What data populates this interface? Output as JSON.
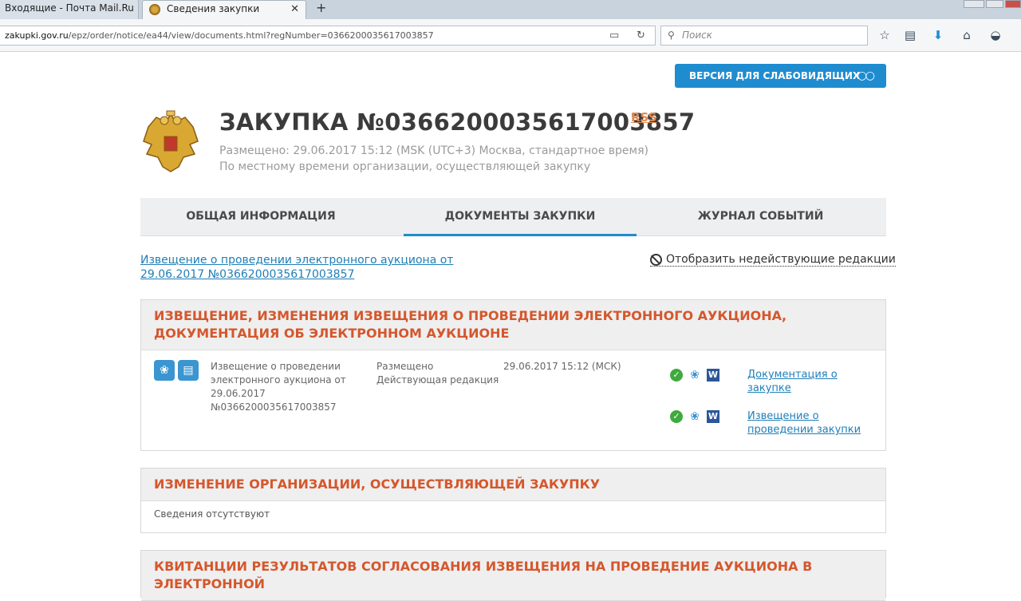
{
  "browser": {
    "tabs": [
      {
        "label": "Входящие - Почта Mail.Ru"
      },
      {
        "label": "Сведения закупки"
      }
    ],
    "new_tab_label": "+",
    "url": {
      "host": "zakupki.gov.ru",
      "path": "/epz/order/notice/ea44/view/documents.html?regNumber=0366200035617003857"
    },
    "search_placeholder": "Поиск"
  },
  "page": {
    "vision_button_label": "ВЕРСИЯ ДЛЯ СЛАБОВИДЯЩИХ",
    "title": "ЗАКУПКА №0366200035617003857",
    "rss_label": "RSS",
    "posted_line": "Размещено: 29.06.2017 15:12 (MSK (UTC+3) Москва, стандартное время)",
    "local_time_line": "По местному времени организации, осуществляющей закупку",
    "tabs": [
      {
        "label": "ОБЩАЯ ИНФОРМАЦИЯ",
        "active": false
      },
      {
        "label": "ДОКУМЕНТЫ ЗАКУПКИ",
        "active": true
      },
      {
        "label": "ЖУРНАЛ СОБЫТИЙ",
        "active": false
      }
    ],
    "notice_link": "Извещение о проведении электронного аукциона от 29.06.2017 №0366200035617003857",
    "show_inactive_label": "Отобразить недействующие редакции"
  },
  "sections": {
    "notice": {
      "title": "ИЗВЕЩЕНИЕ, ИЗМЕНЕНИЯ ИЗВЕЩЕНИЯ О ПРОВЕДЕНИИ ЭЛЕКТРОННОГО АУКЦИОНА, ДОКУМЕНТАЦИЯ ОБ ЭЛЕКТРОННОМ АУКЦИОНЕ",
      "row": {
        "name": "Извещение о проведении электронного аукциона от 29.06.2017 №0366200035617003857",
        "status": "Размещено Действующая редакция",
        "date": "29.06.2017 15:12 (МСК)",
        "documents": [
          {
            "label": "Документация о закупке"
          },
          {
            "label": "Извещение о проведении закупки"
          }
        ]
      }
    },
    "org_change": {
      "title": "ИЗМЕНЕНИЕ ОРГАНИЗАЦИИ, ОСУЩЕСТВЛЯЮЩЕЙ ЗАКУПКУ",
      "empty_text": "Сведения отсутствуют"
    },
    "receipts": {
      "title": "КВИТАНЦИИ РЕЗУЛЬТАТОВ СОГЛАСОВАНИЯ ИЗВЕЩЕНИЯ НА ПРОВЕДЕНИЕ АУКЦИОНА В ЭЛЕКТРОННОЙ"
    }
  },
  "colors": {
    "accent_blue": "#1f8cd0",
    "section_title": "#d5572c",
    "link": "#1f7fb8",
    "ok_green": "#3faa3d"
  }
}
